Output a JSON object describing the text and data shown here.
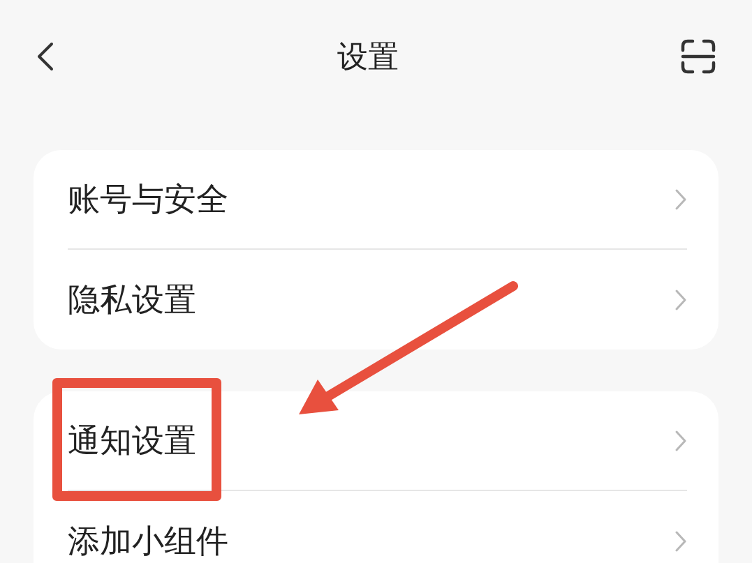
{
  "header": {
    "title": "设置"
  },
  "groups": [
    {
      "items": [
        {
          "label": "账号与安全"
        },
        {
          "label": "隐私设置"
        }
      ]
    },
    {
      "items": [
        {
          "label": "通知设置"
        },
        {
          "label": "添加小组件"
        }
      ]
    }
  ]
}
